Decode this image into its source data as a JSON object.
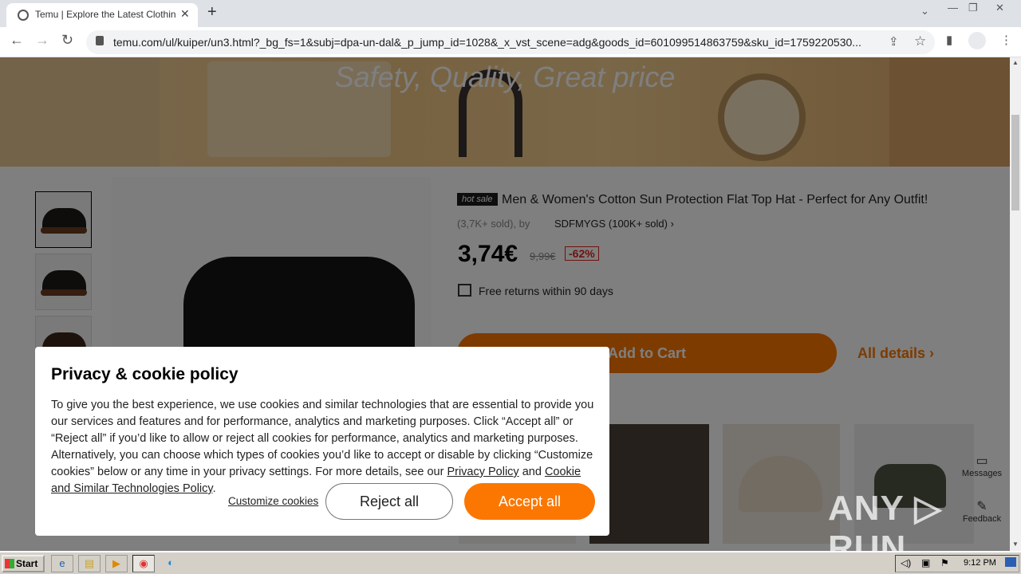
{
  "browser": {
    "tab_title": "Temu | Explore the Latest Clothing, B",
    "url": "temu.com/ul/kuiper/un3.html?_bg_fs=1&subj=dpa-un-dal&_p_jump_id=1028&_x_vst_scene=adg&goods_id=601099514863759&sku_id=1759220530...",
    "close_glyph": "✕",
    "newtab_glyph": "+",
    "back_glyph": "←",
    "forward_glyph": "→",
    "reload_glyph": "↻",
    "share_glyph": "⇪",
    "star_glyph": "☆",
    "sidepanel_glyph": "▮",
    "menu_glyph": "⋮",
    "minimize_glyph": "—",
    "restore_glyph": "❐",
    "winclose_glyph": "✕",
    "tabsearch_glyph": "⌄"
  },
  "banner": {
    "tagline": "Safety, Quality, Great price"
  },
  "product": {
    "badge": "hot sale",
    "title": "Men & Women's Cotton Sun Protection Flat Top Hat - Perfect for Any Outfit!",
    "sold": "(3,7K+ sold), by",
    "seller": "SDFMYGS (100K+ sold) ›",
    "price": "3,74€",
    "old_price": "9,99€",
    "discount": "-62%",
    "returns": "Free returns within 90 days",
    "add_to_cart": "Add to Cart",
    "all_details": "All details ›"
  },
  "side": {
    "messages": "Messages",
    "feedback": "Feedback"
  },
  "cookie": {
    "title": "Privacy & cookie policy",
    "body_text": "To give you the best experience, we use cookies and similar technologies that are essential to provide you our services and features and for performance, analytics and marketing purposes. Click “Accept all” or “Reject all” if you’d like to allow or reject all cookies for performance, analytics and marketing purposes. Alternatively, you can choose which types of cookies you’d like to accept or disable by clicking “Customize cookies” below or any time in your privacy settings. For more details, see our ",
    "privacy_link": "Privacy Policy",
    "and_text": " and ",
    "cookie_link": "Cookie and Similar Technologies Policy",
    "period": ".",
    "customize": "Customize cookies",
    "reject": "Reject all",
    "accept": "Accept all"
  },
  "watermark": "ANY ▷ RUN",
  "taskbar": {
    "start": "Start",
    "clock": "9:12 PM"
  }
}
